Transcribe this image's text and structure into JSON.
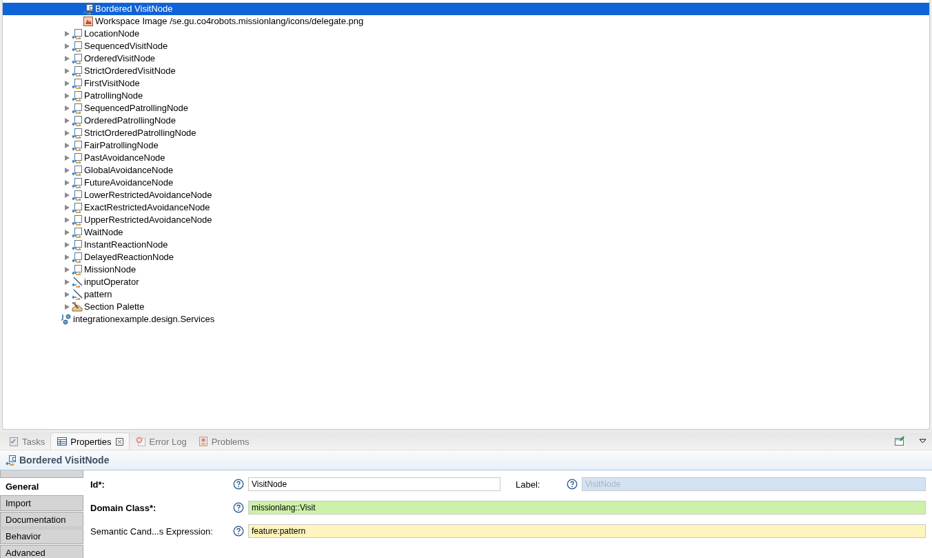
{
  "tree": [
    {
      "kind": "partial",
      "children": [
        {
          "kind": "partial",
          "children": [
            {
              "label": "Bordered VisitNode",
              "kind": "bordered",
              "expandable": false,
              "selected": true
            },
            {
              "label": "Workspace Image /se.gu.co4robots.missionlang/icons/delegate.png",
              "kind": "image",
              "expandable": false,
              "selected": false
            }
          ]
        },
        {
          "label": "LocationNode",
          "kind": "node",
          "expandable": true,
          "selected": false
        },
        {
          "label": "SequencedVisitNode",
          "kind": "node",
          "expandable": true,
          "selected": false
        },
        {
          "label": "OrderedVisitNode",
          "kind": "node",
          "expandable": true,
          "selected": false
        },
        {
          "label": "StrictOrderedVisitNode",
          "kind": "node",
          "expandable": true,
          "selected": false
        },
        {
          "label": "FirstVisitNode",
          "kind": "node",
          "expandable": true,
          "selected": false
        },
        {
          "label": "PatrollingNode",
          "kind": "node",
          "expandable": true,
          "selected": false
        },
        {
          "label": "SequencedPatrollingNode",
          "kind": "node",
          "expandable": true,
          "selected": false
        },
        {
          "label": "OrderedPatrollingNode",
          "kind": "node",
          "expandable": true,
          "selected": false
        },
        {
          "label": "StrictOrderedPatrollingNode",
          "kind": "node",
          "expandable": true,
          "selected": false
        },
        {
          "label": "FairPatrollingNode",
          "kind": "node",
          "expandable": true,
          "selected": false
        },
        {
          "label": "PastAvoidanceNode",
          "kind": "node",
          "expandable": true,
          "selected": false
        },
        {
          "label": "GlobalAvoidanceNode",
          "kind": "node",
          "expandable": true,
          "selected": false
        },
        {
          "label": "FutureAvoidanceNode",
          "kind": "node",
          "expandable": true,
          "selected": false
        },
        {
          "label": "LowerRestrictedAvoidanceNode",
          "kind": "node",
          "expandable": true,
          "selected": false
        },
        {
          "label": "ExactRestrictedAvoidanceNode",
          "kind": "node",
          "expandable": true,
          "selected": false
        },
        {
          "label": "UpperRestrictedAvoidanceNode",
          "kind": "node",
          "expandable": true,
          "selected": false
        },
        {
          "label": "WaitNode",
          "kind": "node",
          "expandable": true,
          "selected": false
        },
        {
          "label": "InstantReactionNode",
          "kind": "node",
          "expandable": true,
          "selected": false
        },
        {
          "label": "DelayedReactionNode",
          "kind": "node",
          "expandable": true,
          "selected": false
        },
        {
          "label": "MissionNode",
          "kind": "node",
          "expandable": true,
          "selected": false
        },
        {
          "label": "inputOperator",
          "kind": "edge",
          "expandable": true,
          "selected": false
        },
        {
          "label": "pattern",
          "kind": "edge",
          "expandable": true,
          "selected": false
        },
        {
          "label": "Section Palette",
          "kind": "palette",
          "expandable": true,
          "selected": false
        }
      ]
    },
    {
      "label": "integrationexample.design.Services",
      "kind": "services",
      "expandable": false,
      "selected": false
    }
  ],
  "view_tabs": [
    {
      "label": "Tasks",
      "kind": "tasks",
      "selected": false
    },
    {
      "label": "Properties",
      "kind": "properties",
      "selected": true
    },
    {
      "label": "Error Log",
      "kind": "errorlog",
      "selected": false
    },
    {
      "label": "Problems",
      "kind": "problems",
      "selected": false
    }
  ],
  "properties": {
    "title": "Bordered VisitNode",
    "sections": [
      {
        "label": "General",
        "selected": true
      },
      {
        "label": "Import",
        "selected": false
      },
      {
        "label": "Documentation",
        "selected": false
      },
      {
        "label": "Behavior",
        "selected": false
      },
      {
        "label": "Advanced",
        "selected": false
      }
    ],
    "rows": [
      [
        {
          "label": "Id*:",
          "required": true,
          "kind": "plain",
          "value": "VisitNode",
          "disabled": false
        },
        {
          "label": "Label:",
          "required": false,
          "kind": "plain",
          "placeholder": "VisitNode",
          "disabled": true
        }
      ],
      [
        {
          "label": "Domain Class*:",
          "required": true,
          "kind": "domain",
          "value": "missionlang::Visit",
          "disabled": false
        }
      ],
      [
        {
          "label": "Semantic Cand...s Expression:",
          "required": false,
          "kind": "expression",
          "value": "feature:pattern",
          "disabled": false
        }
      ]
    ]
  }
}
